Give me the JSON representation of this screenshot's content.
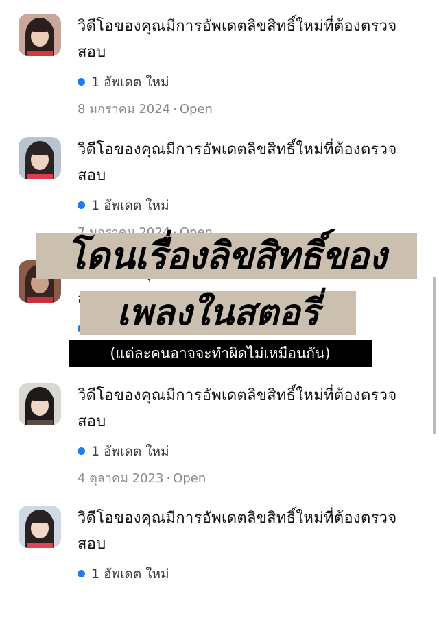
{
  "items": [
    {
      "title": "วิดีโอของคุณมีการอัพเดตลิขสิทธิ์ใหม่ที่ต้องตรวจสอบ",
      "update": "1 อัพเดต ใหม่",
      "date": "8 มกราคม  2024",
      "status": "Open",
      "avatar": {
        "bg": "#c9a79a",
        "hair": "#2a1f1c",
        "skin": "#eccdb8",
        "accent": "#d43a3a"
      }
    },
    {
      "title": "วิดีโอของคุณมีการอัพเดตลิขสิทธิ์ใหม่ที่ต้องตรวจสอบ",
      "update": "1 อัพเดต ใหม่",
      "date": "7 มกราคม  2024",
      "status": "Open",
      "avatar": {
        "bg": "#b9c4cf",
        "hair": "#2b2424",
        "skin": "#f0d2c0",
        "accent": "#e03a4e"
      }
    },
    {
      "title": "วิดีโอของคุณมีการอัพเดตลิขสิทธิ์ใหม่ที่ต้องตรวจสอบ",
      "update": "1 อัพเดต ใหม่",
      "date": "",
      "status": "",
      "avatar": {
        "bg": "#8c5b4a",
        "hair": "#3a2420",
        "skin": "#caa08a",
        "accent": "#c9303a"
      }
    },
    {
      "title": "วิดีโอของคุณมีการอัพเดตลิขสิทธิ์ใหม่ที่ต้องตรวจสอบ",
      "update": "1 อัพเดต ใหม่",
      "date": "4 ตุลาคม  2023",
      "status": "Open",
      "avatar": {
        "bg": "#d9d7d3",
        "hair": "#1e1a1a",
        "skin": "#f1d6c6",
        "accent": "#5a4a44"
      }
    },
    {
      "title": "วิดีโอของคุณมีการอัพเดตลิขสิทธิ์ใหม่ที่ต้องตรวจสอบ",
      "update": "1 อัพเดต ใหม่",
      "date": "",
      "status": "",
      "avatar": {
        "bg": "#cfd8e3",
        "hair": "#2a2222",
        "skin": "#f2d7c7",
        "accent": "#e04358"
      }
    }
  ],
  "overlay": {
    "headline_line1": "โดนเรื่องลิขสิทธิ์ของ",
    "headline_line2": "เพลงในสตอรี่",
    "subcaption": "(แต่ละคนอาจจะทำผิดไม่เหมือนกัน)"
  },
  "colors": {
    "unread_dot": "#1f7cf0",
    "headline_bg": "#cbbfb0",
    "subcaption_bg": "#000000"
  }
}
